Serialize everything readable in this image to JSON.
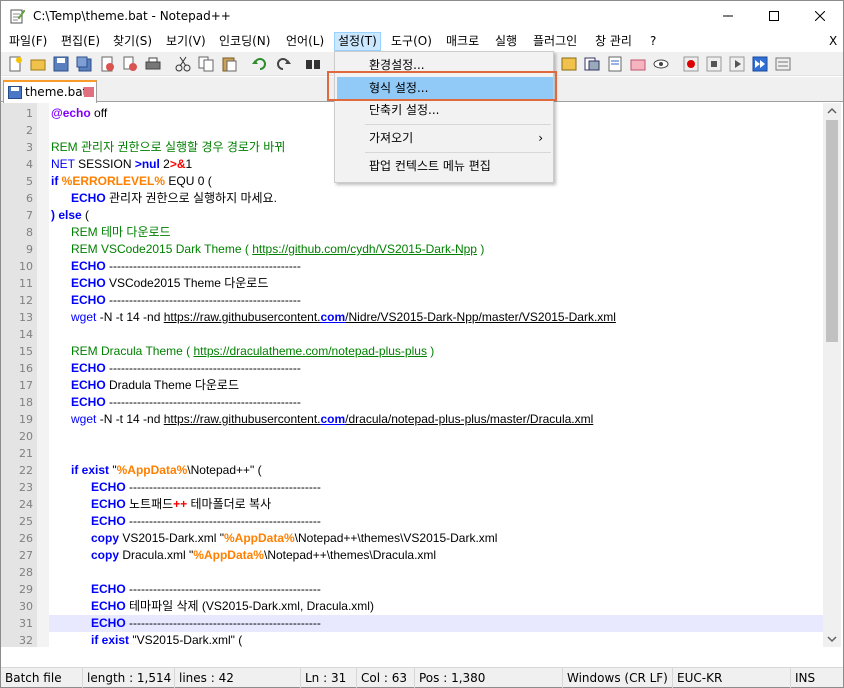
{
  "window": {
    "title": "C:\\Temp\\theme.bat - Notepad++"
  },
  "menubar": {
    "items": [
      "파일(F)",
      "편집(E)",
      "찾기(S)",
      "보기(V)",
      "인코딩(N)",
      "언어(L)",
      "설정(T)",
      "도구(O)",
      "매크로",
      "실행",
      "플러그인",
      "창 관리",
      "?"
    ],
    "close_x": "X"
  },
  "tab": {
    "label": "theme.bat"
  },
  "dropdown": {
    "items": [
      "환경설정...",
      "형식 설정...",
      "단축키 설정...",
      "가져오기",
      "팝업 컨텍스트 메뉴 편집"
    ],
    "highlighted_index": 1,
    "submenu_arrow": "›"
  },
  "editor": {
    "line_numbers": [
      "1",
      "2",
      "3",
      "4",
      "5",
      "6",
      "7",
      "8",
      "9",
      "10",
      "11",
      "12",
      "13",
      "14",
      "15",
      "16",
      "17",
      "18",
      "19",
      "20",
      "21",
      "22",
      "23",
      "24",
      "25",
      "26",
      "27",
      "28",
      "29",
      "30",
      "31",
      "32"
    ],
    "current_line": 31
  },
  "statusbar": {
    "file_type": "Batch file",
    "length": "length : 1,514",
    "lines": "lines : 42",
    "ln": "Ln : 31",
    "col": "Col : 63",
    "pos": "Pos : 1,380",
    "eol": "Windows (CR LF)",
    "encoding": "EUC-KR",
    "mode": "INS"
  },
  "code": {
    "l1_kw": "@echo",
    "l1_rest": " off",
    "l3": "REM 관리자 권한으로 실행할 경우 경로가 바뀌",
    "l4_a": "NET",
    "l4_b": " SESSION ",
    "l4_c": ">nul",
    "l4_d": " 2",
    "l4_e": ">&",
    "l4_f": "1",
    "l5_a": "if",
    "l5_b": " %ERRORLEVEL%",
    "l5_c": " EQU 0 (",
    "l6_a": "ECHO",
    "l6_b": " 관리자 권한으로 실행하지 마세요.",
    "l7_a": ") else",
    "l7_b": " (",
    "l8": "REM 테마 다운로드",
    "l9_a": "REM VSCode2015 Dark Theme ( ",
    "l9_url": "https://github.com/cydh/VS2015-Dark-Npp",
    "l9_b": " )",
    "l10_a": "ECHO",
    "l10_b": " ------------------------------------------------",
    "l11_a": "ECHO",
    "l11_b": " VSCode2015 Theme 다운로드",
    "l12_a": "ECHO",
    "l12_b": " ------------------------------------------------",
    "l13_a": "wget",
    "l13_b": " -N -t 14 -nd ",
    "l13_u1": "https://raw.githubusercontent.",
    "l13_u2": "com",
    "l13_u3": "/Nidre/VS2015-Dark-Npp/master/VS2015-Dark.xml",
    "l15_a": "REM Dracula Theme ( ",
    "l15_url": "https://draculatheme.com/notepad-plus-plus",
    "l15_b": " )",
    "l16_a": "ECHO",
    "l16_b": " ------------------------------------------------",
    "l17_a": "ECHO",
    "l17_b": " Dradula Theme 다운로드",
    "l18_a": "ECHO",
    "l18_b": " ------------------------------------------------",
    "l19_a": "wget",
    "l19_b": " -N -t 14 -nd ",
    "l19_u1": "https://raw.githubusercontent.",
    "l19_u2": "com",
    "l19_u3": "/dracula/notepad-plus-plus/master/Dracula.xml",
    "l22_a": "if exist",
    "l22_b": " \"",
    "l22_c": "%AppData%",
    "l22_d": "\\Notepad++\" (",
    "l23_a": "ECHO",
    "l23_b": " ------------------------------------------------",
    "l24_a": "ECHO",
    "l24_b": " 노트패드",
    "l24_c": "++",
    "l24_d": " 테마폴더로 복사",
    "l25_a": "ECHO",
    "l25_b": " ------------------------------------------------",
    "l26_a": "copy",
    "l26_b": " VS2015-Dark.xml \"",
    "l26_c": "%AppData%",
    "l26_d": "\\Notepad++\\themes\\VS2015-Dark.xml",
    "l27_a": "copy",
    "l27_b": " Dracula.xml \"",
    "l27_c": "%AppData%",
    "l27_d": "\\Notepad++\\themes\\Dracula.xml",
    "l29_a": "ECHO",
    "l29_b": " ------------------------------------------------",
    "l30_a": "ECHO",
    "l30_b": " 테마파일 삭제 (VS2015-Dark.xml, Dracula.xml)",
    "l31_a": "ECHO",
    "l31_b": " ------------------------------------------------",
    "l32_a": "if exist",
    "l32_b": " \"VS2015-Dark.xml\" ("
  }
}
